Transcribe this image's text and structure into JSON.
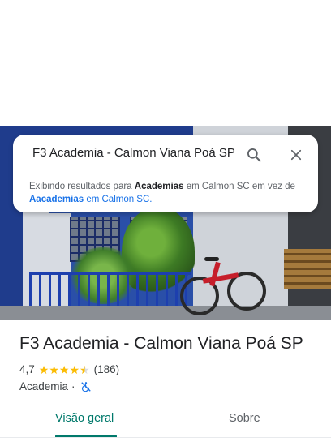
{
  "search": {
    "query": "F3 Academia - Calmon Viana Poá SP",
    "note_prefix": "Exibindo resultados para ",
    "note_bold": "Academias",
    "note_mid": " em Calmon SC em vez de ",
    "note_link_bold": "Aacademias",
    "note_link_rest": " em Calmon SC."
  },
  "place": {
    "name": "F3 Academia - Calmon Viana Poá SP",
    "rating": "4,7",
    "stars": 4.7,
    "reviews": "(186)",
    "category": "Academia",
    "separator": "·",
    "accessibility_icon": "wheelchair-not-accessible-icon"
  },
  "tabs": [
    {
      "label": "Visão geral",
      "selected": true
    },
    {
      "label": "Sobre",
      "selected": false
    }
  ],
  "colors": {
    "accent": "#00796b",
    "star": "#fbbc04",
    "link": "#1a73e8"
  }
}
